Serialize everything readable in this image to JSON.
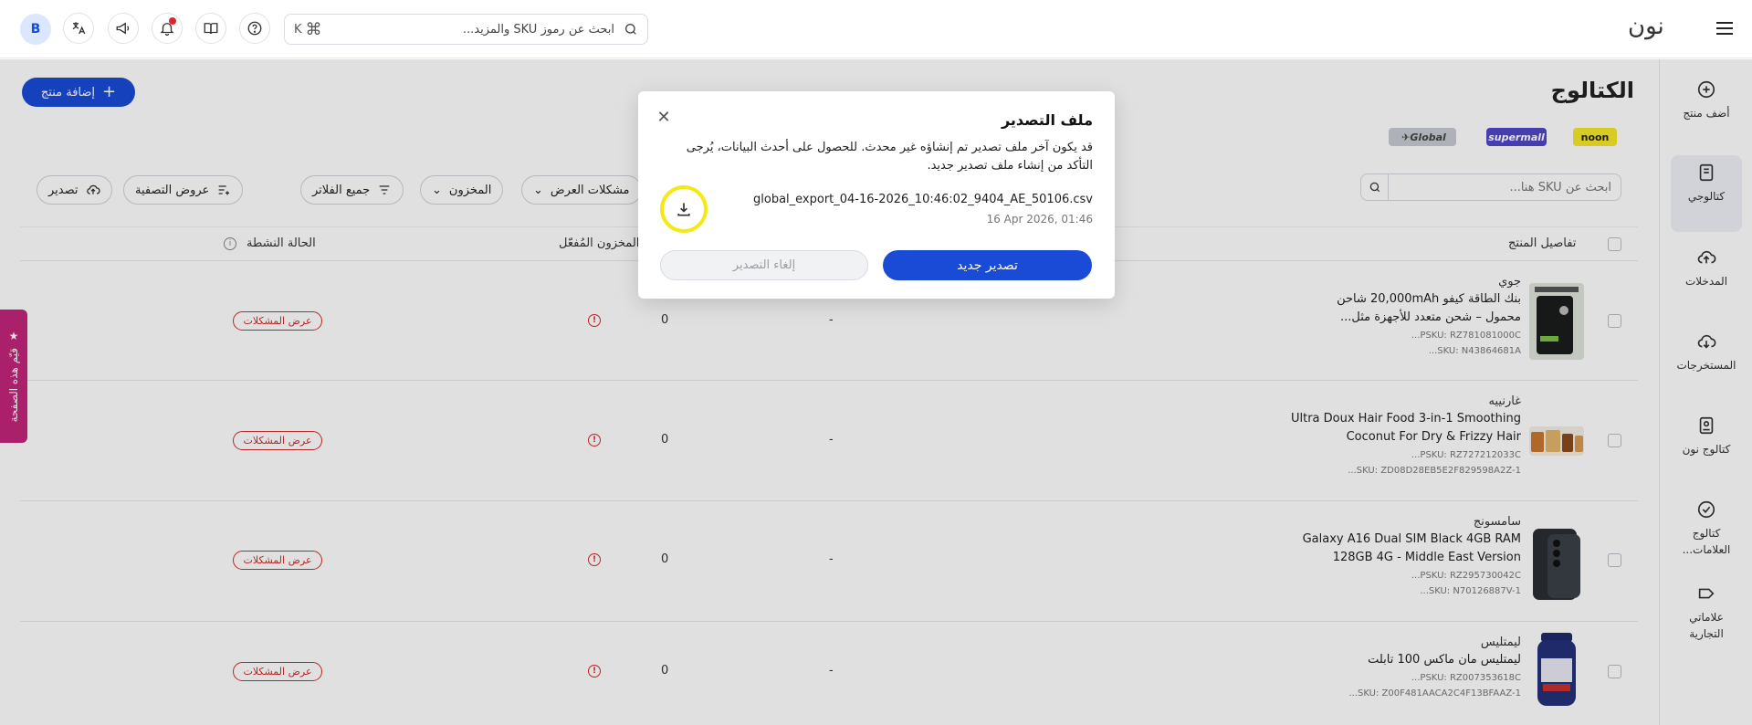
{
  "topbar": {
    "avatar_initial": "B",
    "search_placeholder": "ابحث عن رموز SKU والمزيد...",
    "shortcut_cmd": "⌘",
    "shortcut_key": "K",
    "logo": "نون"
  },
  "sidebar": {
    "items": [
      {
        "label": "أضف منتج",
        "icon": "add-circle-icon"
      },
      {
        "label": "كتالوجي",
        "icon": "catalog-icon"
      },
      {
        "label": "المدخلات",
        "icon": "cloud-upload-icon"
      },
      {
        "label": "المستخرجات",
        "icon": "cloud-download-icon"
      },
      {
        "label": "كتالوج نون",
        "icon": "book-icon"
      },
      {
        "label": "كتالوج العلامات...",
        "icon": "verified-icon"
      },
      {
        "label": "علاماتي التجارية",
        "icon": "tag-icon"
      }
    ]
  },
  "main": {
    "title": "الكتالوج",
    "add_product": "إضافة منتج",
    "badges": {
      "noon": "noon",
      "supermall": "supermall",
      "global": "Global"
    },
    "search_placeholder": "ابحث عن SKU هنا...",
    "filters": {
      "display_issues": "مشكلات العرض",
      "stock": "المخزون",
      "all_filters": "جميع الفلاتر",
      "filter_views": "عروض التصفية",
      "export": "تصدير"
    },
    "table": {
      "col_product": "تفاصيل المنتج",
      "col_active_stock": "المخزون المُفعّل",
      "col_status": "الحالة النشطة"
    },
    "rows": [
      {
        "brand": "جوي",
        "name_line1": "بنك الطاقة كيفو 20,000mAh شاحن",
        "name_line2": "محمول – شحن متعدد للأجهزة مثل...",
        "psku": "PSKU: RZ781081000C...",
        "sku": "SKU: N43864681A...",
        "price": "-",
        "stock": "0",
        "issues": "عرض المشكلات"
      },
      {
        "brand": "غارنييه",
        "name_line1": "Ultra Doux Hair Food 3-in-1 Smoothing",
        "name_line2": "Coconut For Dry & Frizzy Hair",
        "psku": "PSKU: RZ727212033C...",
        "sku": "SKU: ZD08D28EB5E2F829598A2Z-1...",
        "price": "-",
        "stock": "0",
        "issues": "عرض المشكلات"
      },
      {
        "brand": "سامسونج",
        "name_line1": "Galaxy A16 Dual SIM Black 4GB RAM",
        "name_line2": "128GB 4G - Middle East Version",
        "psku": "PSKU: RZ295730042C...",
        "sku": "SKU: N70126887V-1...",
        "price": "-",
        "stock": "0",
        "issues": "عرض المشكلات"
      },
      {
        "brand": "ليمتليس",
        "name_line1": "ليمتليس مان ماكس 100 تابلت",
        "name_line2": "",
        "psku": "PSKU: RZ007353618C...",
        "sku": "SKU: Z00F481AACA2C4F13BFAAZ-1...",
        "price": "-",
        "stock": "0",
        "issues": "عرض المشكلات"
      }
    ],
    "rate_tab": "قيّم هذه الصفحة"
  },
  "modal": {
    "title": "ملف التصدير",
    "message": "قد يكون آخر ملف تصدير تم إنشاؤه غير محدث. للحصول على أحدث البيانات، يُرجى التأكد من إنشاء ملف تصدير جديد.",
    "file_name": "global_export_04-16-2026_10:46:02_9404_AE_50106.csv",
    "file_date": "16 Apr 2026, 01:46",
    "new_export": "تصدير جديد",
    "cancel_export": "إلغاء التصدير"
  },
  "colors": {
    "primary": "#1a4bd6",
    "error": "#d42b2b",
    "highlight": "#f5e817",
    "rate_tab": "#c2257a"
  }
}
